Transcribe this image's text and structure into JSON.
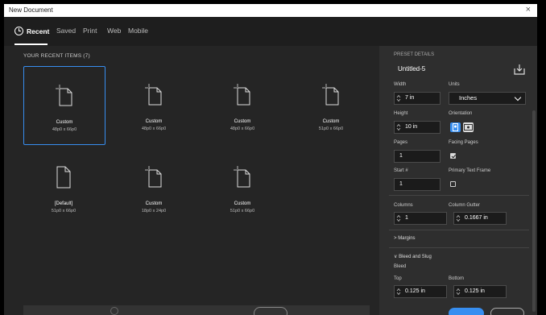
{
  "window": {
    "title": "New Document",
    "close_symbol": "×"
  },
  "tabs": [
    {
      "label": "Recent",
      "active": true
    },
    {
      "label": "Saved"
    },
    {
      "label": "Print"
    },
    {
      "label": "Web"
    },
    {
      "label": "Mobile"
    }
  ],
  "recent": {
    "title": "YOUR RECENT ITEMS (7)",
    "items": [
      {
        "name": "Custom",
        "size": "48p0 x 66p0",
        "selected": true,
        "icon": "document-with-crop-marks-icon"
      },
      {
        "name": "Custom",
        "size": "48p0 x 66p0",
        "icon": "document-with-crop-marks-icon"
      },
      {
        "name": "Custom",
        "size": "48p0 x 66p0",
        "icon": "document-with-crop-marks-icon"
      },
      {
        "name": "Custom",
        "size": "51p0 x 66p0",
        "icon": "document-with-crop-marks-icon"
      },
      {
        "name": "[Default]",
        "size": "51p0 x 66p0",
        "icon": "document-icon"
      },
      {
        "name": "Custom",
        "size": "18p0 x 24p0",
        "icon": "document-with-crop-marks-icon"
      },
      {
        "name": "Custom",
        "size": "51p0 x 66p0",
        "icon": "document-with-crop-marks-icon"
      }
    ]
  },
  "preset": {
    "title": "PRESET DETAILS",
    "doc_name": "Untitled-5",
    "width_label": "Width",
    "width_value": "7 in",
    "units_label": "Units",
    "units_value": "Inches",
    "height_label": "Height",
    "height_value": "10 in",
    "orientation_label": "Orientation",
    "pages_label": "Pages",
    "pages_value": "1",
    "facing_pages_label": "Facing Pages",
    "facing_pages_checked": true,
    "start_label": "Start #",
    "start_value": "1",
    "primary_text_frame_label": "Primary Text Frame",
    "primary_text_frame_checked": false,
    "columns_label": "Columns",
    "columns_value": "1",
    "gutter_label": "Column Gutter",
    "gutter_value": "0.1667 in",
    "margins_label": "Margins",
    "bleed_slug_label": "Bleed and Slug",
    "bleed_label": "Bleed",
    "top_label": "Top",
    "top_value": "0.125 in",
    "bottom_label": "Bottom",
    "bottom_value": "0.125 in"
  },
  "colors": {
    "accent": "#378ef0",
    "dialog_bg": "#222222",
    "panel_bg": "#2e2e2e"
  }
}
